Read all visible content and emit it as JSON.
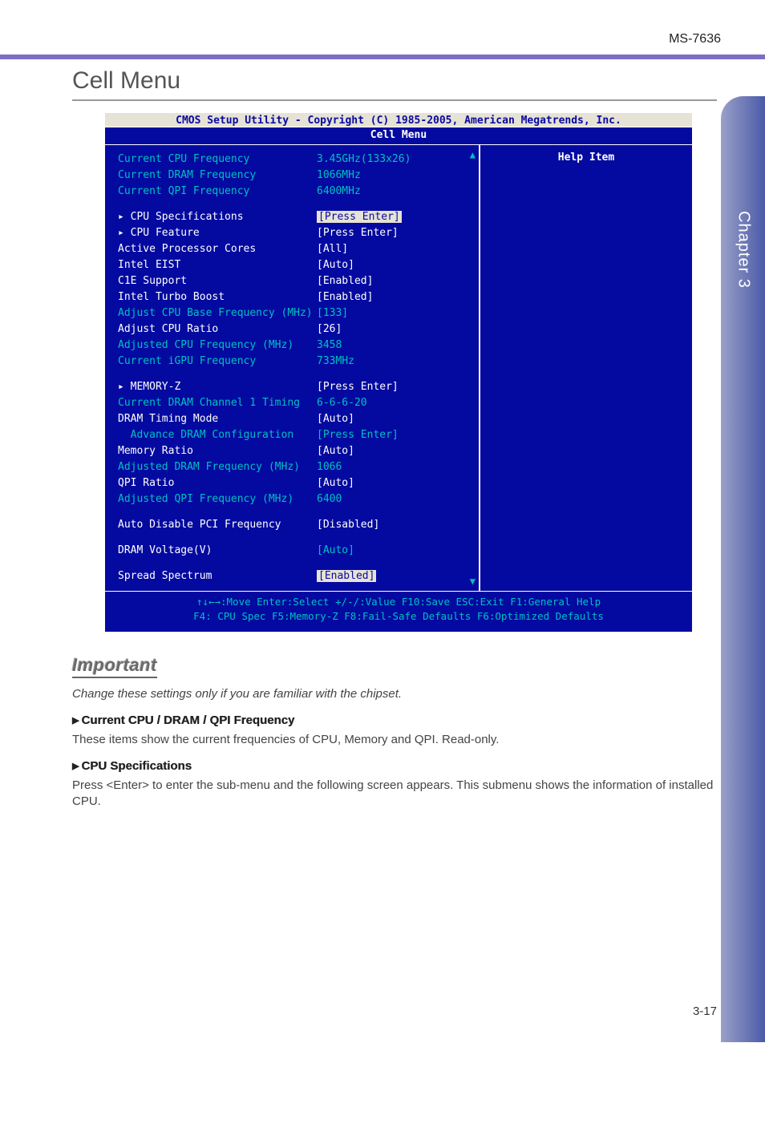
{
  "doc": {
    "model": "MS-7636",
    "section_title": "Cell Menu",
    "chapter_tab": "Chapter 3",
    "page_number": "3-17"
  },
  "bios": {
    "title": "CMOS Setup Utility - Copyright (C) 1985-2005, American Megatrends, Inc.",
    "subtitle": "Cell Menu",
    "help_header": "Help Item",
    "footer_line1": "↑↓←→:Move  Enter:Select  +/-/:Value  F10:Save  ESC:Exit  F1:General Help",
    "footer_line2": "F4: CPU Spec    F5:Memory-Z    F8:Fail-Safe Defaults    F6:Optimized Defaults",
    "rows": {
      "r1": {
        "label": "Current CPU Frequency",
        "value": "3.45GHz(133x26)"
      },
      "r2": {
        "label": "Current DRAM Frequency",
        "value": "1066MHz"
      },
      "r3": {
        "label": "Current QPI Frequency",
        "value": "6400MHz"
      },
      "r4": {
        "label": "▸ CPU Specifications",
        "value": "[Press Enter]"
      },
      "r5": {
        "label": "▸ CPU Feature",
        "value": "[Press Enter]"
      },
      "r6": {
        "label": "Active Processor Cores",
        "value": "[All]"
      },
      "r7": {
        "label": "Intel EIST",
        "value": "[Auto]"
      },
      "r8": {
        "label": "C1E Support",
        "value": "[Enabled]"
      },
      "r9": {
        "label": "Intel Turbo Boost",
        "value": "[Enabled]"
      },
      "r10": {
        "label": "Adjust CPU Base Frequency (MHz)",
        "value": "[133]"
      },
      "r11": {
        "label": "Adjust CPU Ratio",
        "value": "[26]"
      },
      "r12": {
        "label": "Adjusted CPU Frequency (MHz)",
        "value": "3458"
      },
      "r13": {
        "label": "Current iGPU Frequency",
        "value": "733MHz"
      },
      "r14": {
        "label": "▸ MEMORY-Z",
        "value": "[Press Enter]"
      },
      "r15": {
        "label": "Current DRAM Channel 1 Timing",
        "value": "6-6-6-20"
      },
      "r16": {
        "label": "DRAM Timing Mode",
        "value": "[Auto]"
      },
      "r17": {
        "label": "  Advance DRAM Configuration",
        "value": "[Press Enter]"
      },
      "r18": {
        "label": "Memory Ratio",
        "value": "[Auto]"
      },
      "r19": {
        "label": "Adjusted DRAM Frequency (MHz)",
        "value": "1066"
      },
      "r20": {
        "label": "QPI Ratio",
        "value": "[Auto]"
      },
      "r21": {
        "label": "Adjusted QPI Frequency (MHz)",
        "value": "6400"
      },
      "r22": {
        "label": "Auto Disable PCI Frequency",
        "value": "[Disabled]"
      },
      "r23": {
        "label": "DRAM Voltage(V)",
        "value": "[Auto]"
      },
      "r24": {
        "label": "Spread Spectrum",
        "value": "[Enabled]"
      }
    }
  },
  "text": {
    "important_label": "Important",
    "important_body": "Change these settings only if you are familiar with the chipset.",
    "item1_head": "Current CPU / DRAM / QPI Frequency",
    "item1_body": "These items show the current frequencies of CPU, Memory and QPI. Read-only.",
    "item2_head": "CPU Specifications",
    "item2_body": "Press <Enter> to enter the sub-menu and the following screen appears. This submenu shows the information of installed CPU."
  }
}
